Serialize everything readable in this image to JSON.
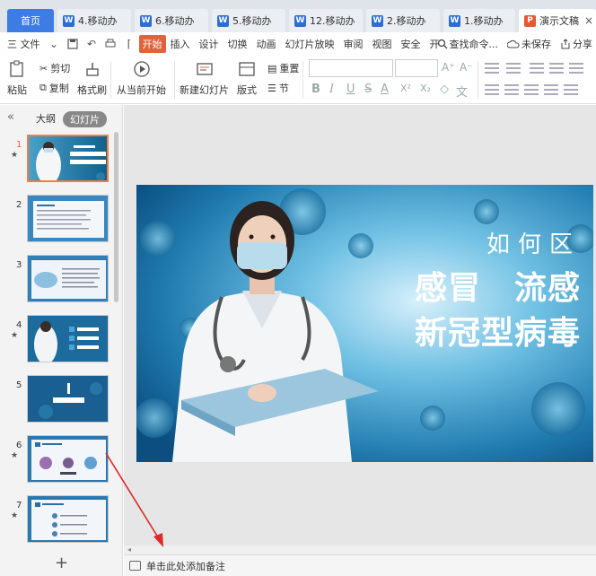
{
  "tabs": [
    {
      "label": "首页",
      "type": "home"
    },
    {
      "label": "4.移动办",
      "type": "doc"
    },
    {
      "label": "6.移动办",
      "type": "doc"
    },
    {
      "label": "5.移动办",
      "type": "doc"
    },
    {
      "label": "12.移动办",
      "type": "doc"
    },
    {
      "label": "2.移动办",
      "type": "doc"
    },
    {
      "label": "1.移动办",
      "type": "doc"
    },
    {
      "label": "演示文稿",
      "type": "ppt",
      "active": true
    }
  ],
  "doc_icon_letter": "W",
  "ppt_icon_letter": "P",
  "menubar": {
    "file": "三 文件",
    "items": [
      "开始",
      "插入",
      "设计",
      "切换",
      "动画",
      "幻灯片放映",
      "审阅",
      "视图",
      "安全",
      "开"
    ],
    "active": "开始",
    "search": "查找命令...",
    "unsaved": "未保存",
    "share": "分享"
  },
  "ribbon": {
    "paste": "粘贴",
    "cut": "剪切",
    "copy": "复制",
    "format_painter": "格式刷",
    "play_from_current": "从当前开始",
    "new_slide": "新建幻灯片",
    "layout": "版式",
    "section": "节",
    "reset": "重置",
    "font_buttons": [
      "B",
      "I",
      "U",
      "S",
      "A",
      "X²",
      "X₂",
      "◇",
      "文"
    ],
    "grow_font": "A⁺",
    "shrink_font": "A⁻"
  },
  "left_panel": {
    "outline_tab": "大纲",
    "slides_tab": "幻灯片",
    "add_slide": "+",
    "slides": [
      {
        "num": "1",
        "star": true,
        "active": true
      },
      {
        "num": "2",
        "star": false
      },
      {
        "num": "3",
        "star": false
      },
      {
        "num": "4",
        "star": true
      },
      {
        "num": "5",
        "star": false
      },
      {
        "num": "6",
        "star": true
      },
      {
        "num": "7",
        "star": true
      }
    ]
  },
  "slide": {
    "line1": "如何区",
    "line2": "感冒　流感",
    "line3": "新冠型病毒"
  },
  "notes": {
    "placeholder": "单击此处添加备注"
  },
  "colors": {
    "accent": "#e2623c",
    "home_tab": "#3d7ce3",
    "slide_bg": "#1b5d8e",
    "arrow": "#e02828"
  }
}
